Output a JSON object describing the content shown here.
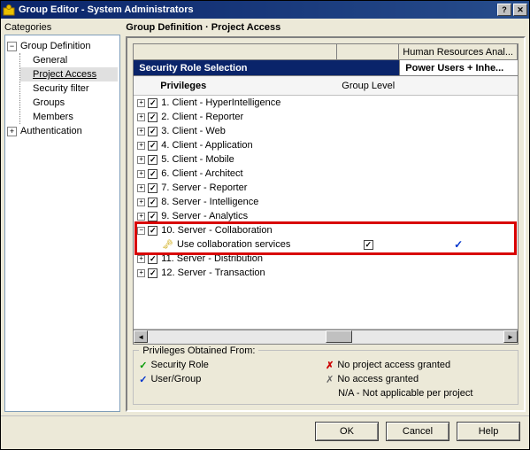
{
  "window": {
    "title": "Group Editor - System Administrators"
  },
  "left": {
    "label": "Categories",
    "root1": "Group Definition",
    "items": [
      "General",
      "Project Access",
      "Security filter",
      "Groups",
      "Members"
    ],
    "root2": "Authentication",
    "selected_index": 1
  },
  "right": {
    "title": "Group Definition · Project Access",
    "header_hr": "Human Resources Anal...",
    "subhead_left": "Security Role Selection",
    "subhead_right": "Power Users + Inhe...",
    "col_priv": "Privileges",
    "col_gl": "Group Level",
    "privileges": [
      {
        "label": "1. Client - HyperIntelligence",
        "expanded": false
      },
      {
        "label": "2. Client - Reporter",
        "expanded": false
      },
      {
        "label": "3. Client - Web",
        "expanded": false
      },
      {
        "label": "4. Client - Application",
        "expanded": false
      },
      {
        "label": "5. Client - Mobile",
        "expanded": false
      },
      {
        "label": "6. Client - Architect",
        "expanded": false
      },
      {
        "label": "7. Server - Reporter",
        "expanded": false
      },
      {
        "label": "8. Server - Intelligence",
        "expanded": false
      },
      {
        "label": "9. Server - Analytics",
        "expanded": false
      },
      {
        "label": "10. Server - Collaboration",
        "expanded": true,
        "children": [
          {
            "label": "Use collaboration services",
            "gl_checked": true,
            "hr_blue": true
          }
        ]
      },
      {
        "label": "11. Server - Distribution",
        "expanded": false
      },
      {
        "label": "12. Server - Transaction",
        "expanded": false
      }
    ],
    "legend": {
      "title": "Privileges Obtained From:",
      "l1": "Security Role",
      "l2": "User/Group",
      "r1": "No project access granted",
      "r2": "No access granted",
      "r3": "N/A - Not applicable per project"
    }
  },
  "buttons": {
    "ok": "OK",
    "cancel": "Cancel",
    "help": "Help"
  }
}
